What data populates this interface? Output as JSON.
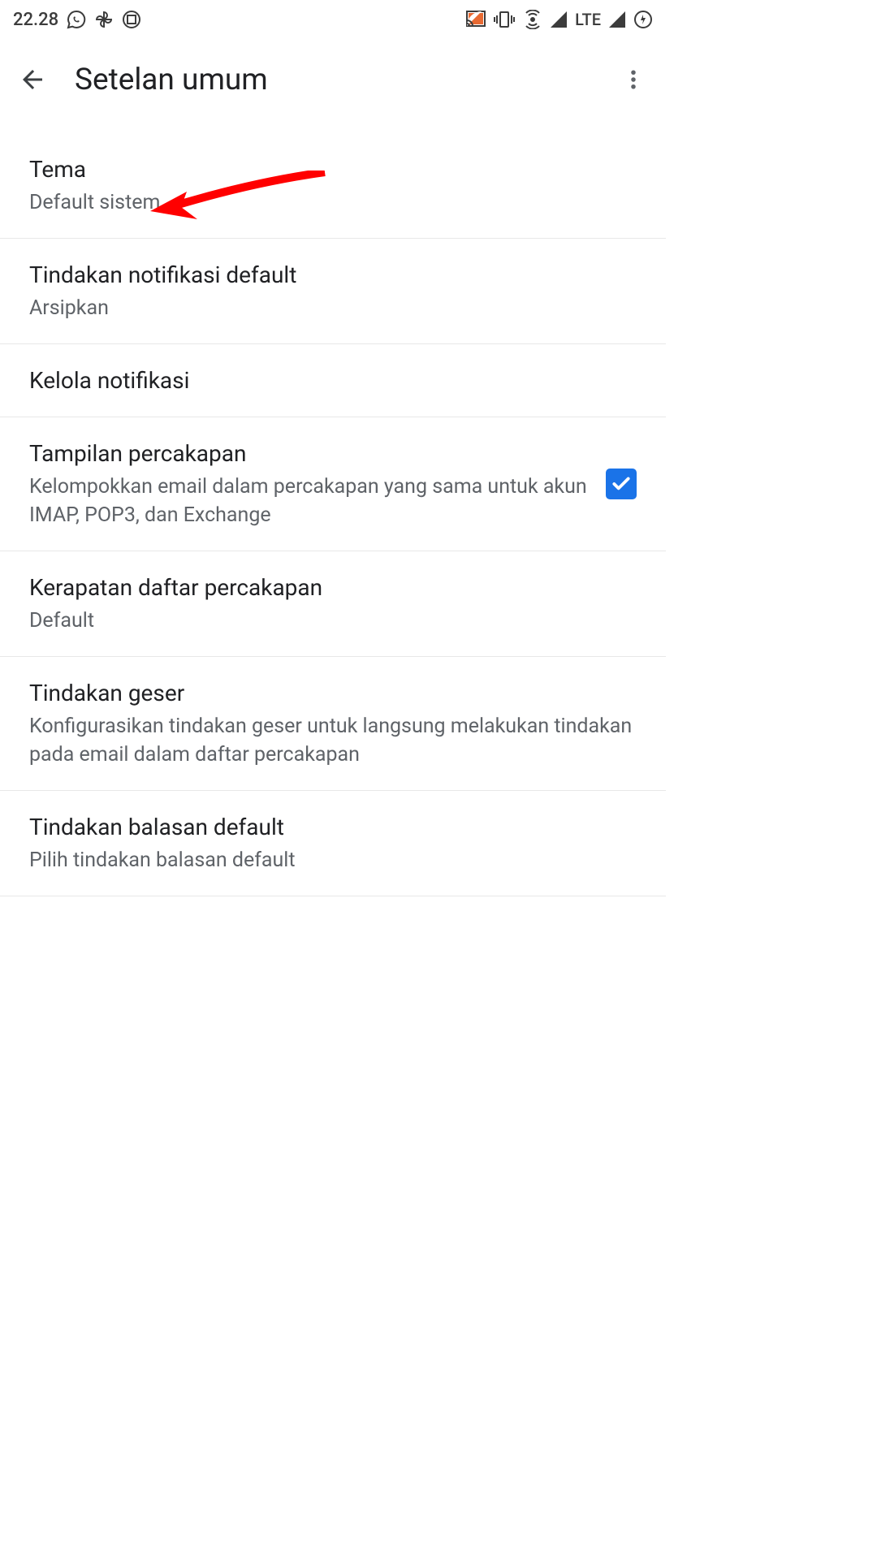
{
  "statusBar": {
    "time": "22.28",
    "network": "LTE"
  },
  "appBar": {
    "title": "Setelan umum"
  },
  "settings": {
    "theme": {
      "title": "Tema",
      "subtitle": "Default sistem"
    },
    "defaultNotifAction": {
      "title": "Tindakan notifikasi default",
      "subtitle": "Arsipkan"
    },
    "manageNotif": {
      "title": "Kelola notifikasi"
    },
    "conversationView": {
      "title": "Tampilan percakapan",
      "subtitle": "Kelompokkan email dalam percakapan yang sama untuk akun IMAP, POP3, dan Exchange",
      "checked": true
    },
    "listDensity": {
      "title": "Kerapatan daftar percakapan",
      "subtitle": "Default"
    },
    "swipeAction": {
      "title": "Tindakan geser",
      "subtitle": "Konfigurasikan tindakan geser untuk langsung melakukan tindakan pada email dalam daftar percakapan"
    },
    "defaultReply": {
      "title": "Tindakan balasan default",
      "subtitle": "Pilih tindakan balasan default"
    }
  }
}
